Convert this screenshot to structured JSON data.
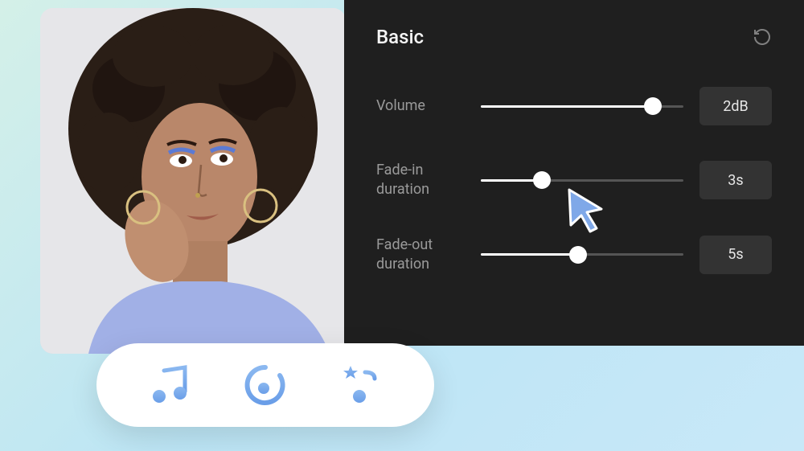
{
  "panel": {
    "title": "Basic",
    "controls": [
      {
        "label": "Volume",
        "value": "2dB",
        "percent": 85
      },
      {
        "label": "Fade-in duration",
        "value": "3s",
        "percent": 30
      },
      {
        "label": "Fade-out duration",
        "value": "5s",
        "percent": 48
      }
    ]
  },
  "toolbar": {
    "items": [
      "music",
      "source",
      "effects"
    ]
  }
}
